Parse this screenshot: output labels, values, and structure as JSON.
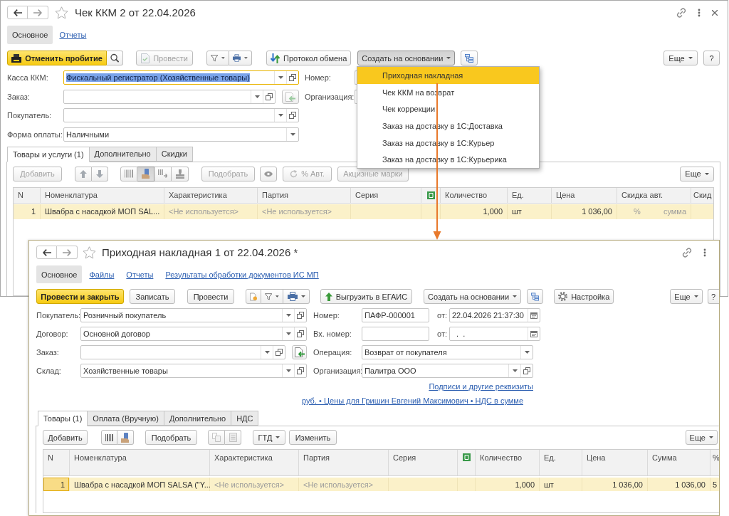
{
  "receipt_window": {
    "title": "Чек ККМ 2 от 22.04.2026",
    "nav_tabs": [
      {
        "label": "Основное",
        "selected": true
      },
      {
        "label": "Отчеты",
        "selected": false
      }
    ],
    "toolbar": {
      "cancel_posting": {
        "label": "Отменить пробитие"
      },
      "post": {
        "label": "Провести",
        "disabled": true
      },
      "exchange_log": {
        "label": "Протокол обмена"
      },
      "create_based_on": {
        "label": "Создать на основании",
        "expanded": true
      },
      "more": {
        "label": "Еще"
      },
      "help": {
        "label": "?"
      }
    },
    "fields": [
      {
        "kind": "reference",
        "label": "Касса ККМ:",
        "value": "Фискальный регистратор (Хозяйственные товары)",
        "focused": true
      },
      {
        "kind": "reference",
        "label": "Заказ:",
        "focused": false,
        "side_button": {
          "disabled": true
        }
      },
      {
        "kind": "reference",
        "label": "Покупатель:",
        "focused": false
      },
      {
        "kind": "list",
        "label": "Форма оплаты:",
        "value": "Наличными",
        "focused": false
      }
    ],
    "side_fields": [
      {
        "label": "Номер:"
      },
      {
        "label": "Организация:"
      }
    ],
    "tabs": [
      {
        "label": "Товары и услуги (1)",
        "selected": true
      },
      {
        "label": "Дополнительно",
        "selected": false
      },
      {
        "label": "Скидки",
        "selected": false
      }
    ],
    "table_toolbar": {
      "add": {
        "label": "Добавить",
        "disabled": true
      },
      "scanner": {
        "on": true
      },
      "pick": {
        "label": "Подобрать",
        "disabled": true
      },
      "auto_discount": {
        "label": "% Авт.",
        "disabled": true
      },
      "excise_marks": {
        "label": "Акцизные марки",
        "disabled": true
      },
      "more": {
        "label": "Еще",
        "disabled": false
      }
    },
    "table": {
      "columns": [
        {
          "kind": "number",
          "label": "N"
        },
        {
          "kind": "text",
          "label": "Номенклатура"
        },
        {
          "kind": "text",
          "label": "Характеристика"
        },
        {
          "kind": "text",
          "label": "Партия"
        },
        {
          "kind": "text",
          "label": "Серия"
        },
        {
          "kind": "icon"
        },
        {
          "kind": "number",
          "label": "Количество"
        },
        {
          "kind": "text",
          "label": "Ед."
        },
        {
          "kind": "number",
          "label": "Цена"
        },
        {
          "kind": "split",
          "label": "Скидка авт."
        },
        {
          "kind": "text",
          "label": "Скид"
        }
      ],
      "rows": [
        {
          "selected": true,
          "cells": [
            {
              "text": "1",
              "muted": false
            },
            {
              "text": "Швабра с насадкой МОП SAL...",
              "muted": false
            },
            {
              "text": "<Не используется>",
              "muted": true
            },
            {
              "text": "<Не используется>",
              "muted": true
            },
            null,
            null,
            {
              "text": "1,000",
              "muted": false
            },
            {
              "text": "шт",
              "muted": false
            },
            {
              "text": "1 036,00",
              "muted": false
            },
            {
              "parts": [
                {
                  "text": "%",
                  "muted": true
                },
                {
                  "text": "сумма",
                  "muted": true
                }
              ]
            },
            null
          ]
        }
      ]
    }
  },
  "create_menu": {
    "items": [
      {
        "label": "Приходная накладная",
        "selected": true
      },
      {
        "label": "Чек ККМ на возврат",
        "selected": false
      },
      {
        "label": "Чек коррекции",
        "selected": false
      },
      {
        "label": "Заказ на доставку в 1С:Доставка",
        "selected": false
      },
      {
        "label": "Заказ на доставку в 1С:Курьер",
        "selected": false
      },
      {
        "label": "Заказ на доставку в 1С:Курьерика",
        "selected": false
      }
    ]
  },
  "invoice_window": {
    "title": "Приходная накладная 1 от 22.04.2026 *",
    "nav_tabs": [
      {
        "label": "Основное",
        "selected": true
      },
      {
        "label": "Файлы",
        "selected": false
      },
      {
        "label": "Отчеты",
        "selected": false
      },
      {
        "label": "Результаты обработки документов ИС МП",
        "selected": false
      }
    ],
    "toolbar": {
      "post_and_close": {
        "label": "Провести и закрыть"
      },
      "save": {
        "label": "Записать"
      },
      "post": {
        "label": "Провести",
        "disabled": false
      },
      "upload_egais": {
        "label": "Выгрузить в ЕГАИС"
      },
      "create_based_on": {
        "label": "Создать на основании",
        "expanded": false
      },
      "settings": {
        "label": "Настройка"
      },
      "more": {
        "label": "Еще"
      },
      "help": {
        "label": "?"
      }
    },
    "fields_left": [
      {
        "kind": "reference",
        "label": "Покупатель:",
        "value": "Розничный покупатель"
      },
      {
        "kind": "reference",
        "label": "Договор:",
        "value": "Основной договор"
      },
      {
        "kind": "reference",
        "label": "Заказ:",
        "side_button": {
          "disabled": false
        }
      },
      {
        "kind": "reference",
        "label": "Склад:",
        "value": "Хозяйственные товары"
      }
    ],
    "fields_right": [
      {
        "kind": "text",
        "label": "Номер:",
        "value": "ПАФР-000001",
        "date": {
          "label": "от:",
          "value": "22.04.2026 21:37:30"
        }
      },
      {
        "kind": "text",
        "label": "Вх. номер:",
        "date": {
          "label": "от:",
          "value": "  .  ."
        }
      },
      {
        "kind": "list",
        "label": "Операция:",
        "value": "Возврат от покупателя"
      },
      {
        "kind": "reference",
        "label": "Организация:",
        "value": "Палитра ООО"
      }
    ],
    "links": [
      "Подписи и другие реквизиты",
      "руб. • Цены для Гришин Евгений Максимович • НДС в сумме"
    ],
    "tabs": [
      {
        "label": "Товары (1)",
        "selected": true
      },
      {
        "label": "Оплата (Вручную)",
        "selected": false
      },
      {
        "label": "Дополнительно",
        "selected": false
      },
      {
        "label": "НДС",
        "selected": false
      }
    ],
    "table_toolbar": {
      "add": {
        "label": "Добавить"
      },
      "scanner": {
        "on": false
      },
      "pick": {
        "label": "Подобрать"
      },
      "copy": {
        "disabled": true
      },
      "paste": {
        "disabled": true
      },
      "gtd": {
        "label": "ГТД"
      },
      "change": {
        "label": "Изменить"
      },
      "more": {
        "label": "Еще"
      }
    },
    "table": {
      "columns": [
        {
          "kind": "number",
          "label": "N"
        },
        {
          "kind": "text",
          "label": "Номенклатура"
        },
        {
          "kind": "text",
          "label": "Характеристика"
        },
        {
          "kind": "text",
          "label": "Партия"
        },
        {
          "kind": "text",
          "label": "Серия"
        },
        {
          "kind": "icon"
        },
        {
          "kind": "number",
          "label": "Количество"
        },
        {
          "kind": "text",
          "label": "Ед."
        },
        {
          "kind": "number",
          "label": "Цена"
        },
        {
          "kind": "number",
          "label": "Сумма"
        },
        {
          "kind": "text",
          "label": "%"
        }
      ],
      "rows": [
        {
          "selected": true,
          "cells": [
            {
              "text": "1",
              "muted": false,
              "focused": true
            },
            {
              "text": "Швабра с насадкой МОП SALSA (\"Y...",
              "muted": false,
              "focused": false
            },
            {
              "text": "<Не используется>",
              "muted": true,
              "focused": false
            },
            {
              "text": "<Не используется>",
              "muted": true,
              "focused": false
            },
            null,
            null,
            {
              "text": "1,000",
              "muted": false,
              "focused": false
            },
            {
              "text": "шт",
              "muted": false,
              "focused": false
            },
            {
              "text": "1 036,00",
              "muted": false,
              "focused": false
            },
            {
              "text": "1 036,00",
              "muted": false,
              "focused": false
            },
            {
              "text": "5",
              "muted": false,
              "focused": false
            }
          ]
        }
      ]
    }
  }
}
